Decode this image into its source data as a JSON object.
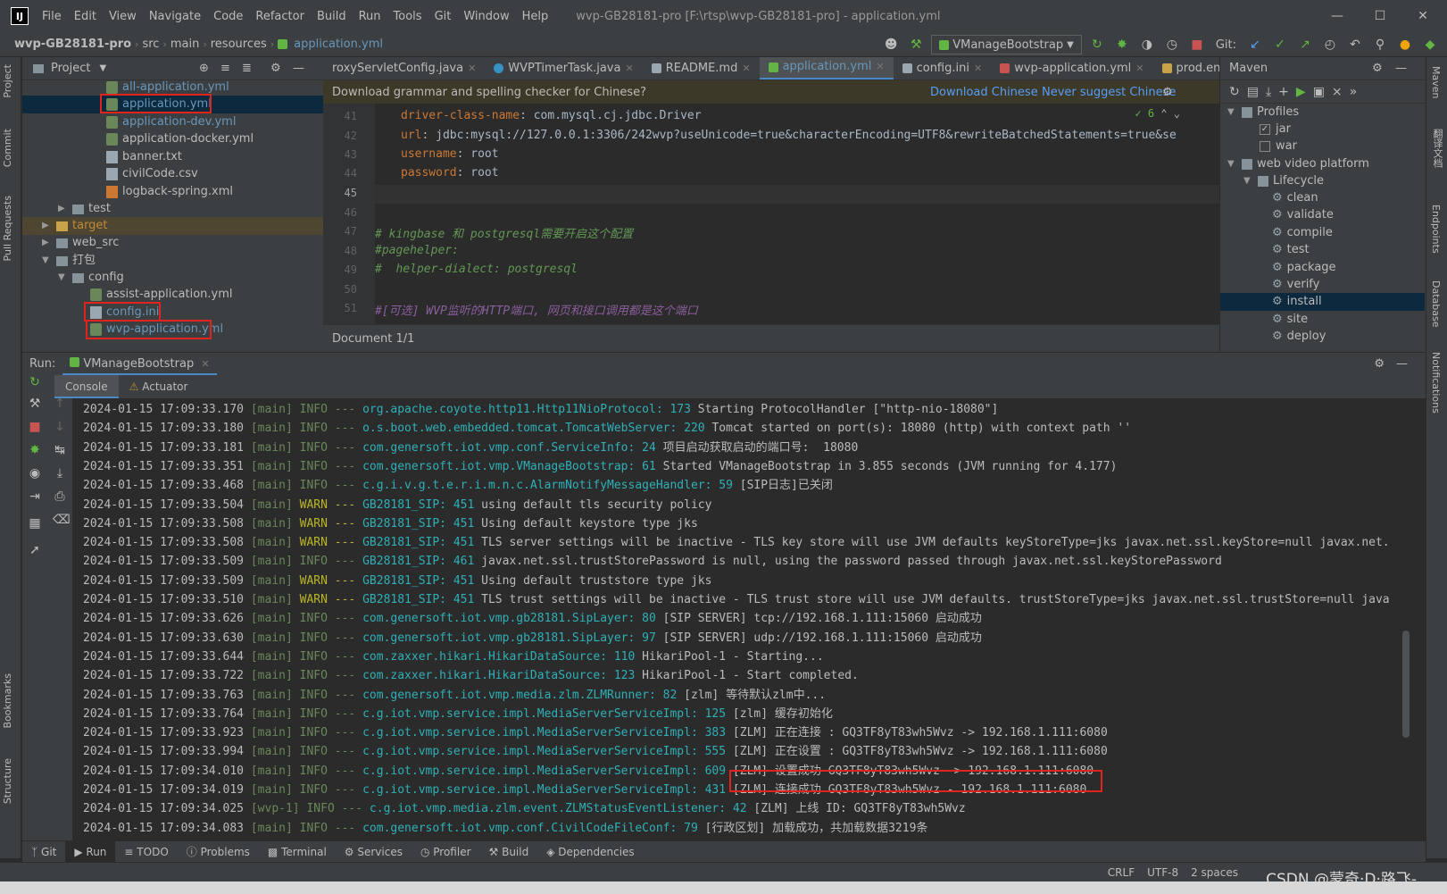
{
  "titlebar": {
    "app_icon": "IJ",
    "menu": [
      "File",
      "Edit",
      "View",
      "Navigate",
      "Code",
      "Refactor",
      "Build",
      "Run",
      "Tools",
      "Git",
      "Window",
      "Help"
    ],
    "window_title": "wvp-GB28181-pro [F:\\rtsp\\wvp-GB28181-pro] - application.yml"
  },
  "navbar": {
    "breadcrumbs": [
      "wvp-GB28181-pro",
      "src",
      "main",
      "resources",
      "application.yml"
    ],
    "run_config": "VManageBootstrap",
    "git_label": "Git:"
  },
  "project": {
    "title": "Project",
    "rows": [
      {
        "label": "all-application.yml",
        "icon": "yml-icon",
        "indent": 4
      },
      {
        "label": "application.yml",
        "icon": "yml-icon",
        "indent": 4
      },
      {
        "label": "application-dev.yml",
        "icon": "yml-icon",
        "indent": 4
      },
      {
        "label": "application-docker.yml",
        "icon": "yml-icon",
        "indent": 4
      },
      {
        "label": "banner.txt",
        "icon": "txt-icon",
        "indent": 4
      },
      {
        "label": "civilCode.csv",
        "icon": "txt-icon",
        "indent": 4
      },
      {
        "label": "logback-spring.xml",
        "icon": "xml-icon",
        "indent": 4
      },
      {
        "label": "test",
        "icon": "folder-icon",
        "indent": 2
      },
      {
        "label": "target",
        "icon": "folder-icon",
        "indent": 1
      },
      {
        "label": "web_src",
        "icon": "folder-icon",
        "indent": 1
      },
      {
        "label": "打包",
        "icon": "folder-icon",
        "indent": 1
      },
      {
        "label": "config",
        "icon": "folder-icon",
        "indent": 2
      },
      {
        "label": "assist-application.yml",
        "icon": "yml-icon",
        "indent": 3
      },
      {
        "label": "config.ini",
        "icon": "ini-icon",
        "indent": 3
      },
      {
        "label": "wvp-application.yml",
        "icon": "yml-icon",
        "indent": 3
      }
    ]
  },
  "editor": {
    "tabs": [
      {
        "label": "roxyServletConfig.java"
      },
      {
        "label": "WVPTimerTask.java"
      },
      {
        "label": "README.md"
      },
      {
        "label": "application.yml",
        "active": true
      },
      {
        "label": "config.ini"
      },
      {
        "label": "wvp-application.yml"
      },
      {
        "label": "prod.env.js"
      }
    ],
    "banner_text": "Download grammar and spelling checker for Chinese?",
    "banner_link1": "Download Chinese",
    "banner_link2": "Never suggest Chinese",
    "inspection_count": "6",
    "lines": [
      {
        "num": "41",
        "key": "driver-class-name",
        "value": "com.mysql.cj.jdbc.Driver"
      },
      {
        "num": "42",
        "key": "url",
        "value": "jdbc:mysql://127.0.0.1:3306/242wvp?useUnicode=true&characterEncoding=UTF8&rewriteBatchedStatements=true&se"
      },
      {
        "num": "43",
        "key": "username",
        "value": "root"
      },
      {
        "num": "44",
        "key": "password",
        "value": "root"
      },
      {
        "num": "45",
        "text": ""
      },
      {
        "num": "46",
        "text": ""
      },
      {
        "num": "47",
        "comment": "# kingbase 和 postgresql需要开启这个配置"
      },
      {
        "num": "48",
        "comment": "#pagehelper:"
      },
      {
        "num": "49",
        "comment": "#  helper-dialect: postgresql"
      },
      {
        "num": "50",
        "text": ""
      },
      {
        "num": "51",
        "comment": "#[可选] WVP监听的HTTP端口, 网页和接口调用都是这个端口"
      }
    ],
    "status": "Document 1/1"
  },
  "maven": {
    "title": "Maven",
    "rows": [
      {
        "label": "Profiles"
      },
      {
        "label": "jar",
        "checked": true
      },
      {
        "label": "war",
        "checked": false
      },
      {
        "label": "web video platform"
      },
      {
        "label": "Lifecycle"
      },
      {
        "label": "clean"
      },
      {
        "label": "validate"
      },
      {
        "label": "compile"
      },
      {
        "label": "test"
      },
      {
        "label": "package"
      },
      {
        "label": "verify"
      },
      {
        "label": "install"
      },
      {
        "label": "site"
      },
      {
        "label": "deploy"
      }
    ]
  },
  "run": {
    "label": "Run:",
    "tab": "VManageBootstrap",
    "console_tab": "Console",
    "actuator_tab": "Actuator",
    "logs": [
      {
        "ts": "2024-01-15 17:09:33.170",
        "th": "[main]",
        "lvl": "INFO",
        "cls": "org.apache.coyote.http11.Http11NioProtocol: 173",
        "msg": "Starting ProtocolHandler [\"http-nio-18080\"]"
      },
      {
        "ts": "2024-01-15 17:09:33.180",
        "th": "[main]",
        "lvl": "INFO",
        "cls": "o.s.boot.web.embedded.tomcat.TomcatWebServer: 220",
        "msg": "Tomcat started on port(s): 18080 (http) with context path ''"
      },
      {
        "ts": "2024-01-15 17:09:33.181",
        "th": "[main]",
        "lvl": "INFO",
        "cls": "com.genersoft.iot.vmp.conf.ServiceInfo: 24",
        "msg": "项目启动获取启动的端口号:  18080"
      },
      {
        "ts": "2024-01-15 17:09:33.351",
        "th": "[main]",
        "lvl": "INFO",
        "cls": "com.genersoft.iot.vmp.VManageBootstrap: 61",
        "msg": "Started VManageBootstrap in 3.855 seconds (JVM running for 4.177)"
      },
      {
        "ts": "2024-01-15 17:09:33.468",
        "th": "[main]",
        "lvl": "INFO",
        "cls": "c.g.i.v.g.t.e.r.i.m.n.c.AlarmNotifyMessageHandler: 59",
        "msg": "[SIP日志]已关闭"
      },
      {
        "ts": "2024-01-15 17:09:33.504",
        "th": "[main]",
        "lvl": "WARN",
        "cls": "GB28181_SIP: 451",
        "msg": "using default tls security policy"
      },
      {
        "ts": "2024-01-15 17:09:33.508",
        "th": "[main]",
        "lvl": "WARN",
        "cls": "GB28181_SIP: 451",
        "msg": "Using default keystore type jks"
      },
      {
        "ts": "2024-01-15 17:09:33.508",
        "th": "[main]",
        "lvl": "WARN",
        "cls": "GB28181_SIP: 451",
        "msg": "TLS server settings will be inactive - TLS key store will use JVM defaults keyStoreType=jks javax.net.ssl.keyStore=null javax.net."
      },
      {
        "ts": "2024-01-15 17:09:33.509",
        "th": "[main]",
        "lvl": "INFO",
        "cls": "GB28181_SIP: 461",
        "msg": "javax.net.ssl.trustStorePassword is null, using the password passed through javax.net.ssl.keyStorePassword"
      },
      {
        "ts": "2024-01-15 17:09:33.509",
        "th": "[main]",
        "lvl": "WARN",
        "cls": "GB28181_SIP: 451",
        "msg": "Using default truststore type jks"
      },
      {
        "ts": "2024-01-15 17:09:33.510",
        "th": "[main]",
        "lvl": "WARN",
        "cls": "GB28181_SIP: 451",
        "msg": "TLS trust settings will be inactive - TLS trust store will use JVM defaults. trustStoreType=jks javax.net.ssl.trustStore=null java"
      },
      {
        "ts": "2024-01-15 17:09:33.626",
        "th": "[main]",
        "lvl": "INFO",
        "cls": "com.genersoft.iot.vmp.gb28181.SipLayer: 80",
        "msg": "[SIP SERVER] tcp://192.168.1.111:15060 启动成功"
      },
      {
        "ts": "2024-01-15 17:09:33.630",
        "th": "[main]",
        "lvl": "INFO",
        "cls": "com.genersoft.iot.vmp.gb28181.SipLayer: 97",
        "msg": "[SIP SERVER] udp://192.168.1.111:15060 启动成功"
      },
      {
        "ts": "2024-01-15 17:09:33.644",
        "th": "[main]",
        "lvl": "INFO",
        "cls": "com.zaxxer.hikari.HikariDataSource: 110",
        "msg": "HikariPool-1 - Starting..."
      },
      {
        "ts": "2024-01-15 17:09:33.722",
        "th": "[main]",
        "lvl": "INFO",
        "cls": "com.zaxxer.hikari.HikariDataSource: 123",
        "msg": "HikariPool-1 - Start completed."
      },
      {
        "ts": "2024-01-15 17:09:33.763",
        "th": "[main]",
        "lvl": "INFO",
        "cls": "com.genersoft.iot.vmp.media.zlm.ZLMRunner: 82",
        "msg": "[zlm] 等待默认zlm中..."
      },
      {
        "ts": "2024-01-15 17:09:33.764",
        "th": "[main]",
        "lvl": "INFO",
        "cls": "c.g.iot.vmp.service.impl.MediaServerServiceImpl: 125",
        "msg": "[zlm] 缓存初始化"
      },
      {
        "ts": "2024-01-15 17:09:33.923",
        "th": "[main]",
        "lvl": "INFO",
        "cls": "c.g.iot.vmp.service.impl.MediaServerServiceImpl: 383",
        "msg": "[ZLM] 正在连接 : GQ3TF8yT83wh5Wvz -> 192.168.1.111:6080"
      },
      {
        "ts": "2024-01-15 17:09:33.994",
        "th": "[main]",
        "lvl": "INFO",
        "cls": "c.g.iot.vmp.service.impl.MediaServerServiceImpl: 555",
        "msg": "[ZLM] 正在设置 : GQ3TF8yT83wh5Wvz -> 192.168.1.111:6080"
      },
      {
        "ts": "2024-01-15 17:09:34.010",
        "th": "[main]",
        "lvl": "INFO",
        "cls": "c.g.iot.vmp.service.impl.MediaServerServiceImpl: 609",
        "msg": "[ZLM] 设置成功 GQ3TF8yT83wh5Wvz -> 192.168.1.111:6080"
      },
      {
        "ts": "2024-01-15 17:09:34.019",
        "th": "[main]",
        "lvl": "INFO",
        "cls": "c.g.iot.vmp.service.impl.MediaServerServiceImpl: 431",
        "msg": "[ZLM] 连接成功 GQ3TF8yT83wh5Wvz - 192.168.1.111:6080"
      },
      {
        "ts": "2024-01-15 17:09:34.025",
        "th": "[wvp-1]",
        "lvl": "INFO",
        "cls": "c.g.iot.vmp.media.zlm.event.ZLMStatusEventListener: 42",
        "msg": "[ZLM] 上线 ID: GQ3TF8yT83wh5Wvz"
      },
      {
        "ts": "2024-01-15 17:09:34.083",
        "th": "[main]",
        "lvl": "INFO",
        "cls": "com.genersoft.iot.vmp.conf.CivilCodeFileConf: 79",
        "msg": "[行政区划] 加载成功，共加载数据3219条"
      }
    ]
  },
  "bottom_tabs": [
    "Git",
    "Run",
    "TODO",
    "Problems",
    "Terminal",
    "Services",
    "Profiler",
    "Build",
    "Dependencies"
  ],
  "statusbar": {
    "line_sep": "CRLF",
    "encoding": "UTF-8",
    "indent": "2 spaces"
  },
  "left_strip": [
    "Project",
    "Commit",
    "Pull Requests",
    "Bookmarks",
    "Structure"
  ],
  "right_strip": [
    "Maven",
    "翻译文档",
    "Endpoints",
    "Database",
    "Notifications"
  ],
  "watermark": "CSDN @蒙奇·D·路飞-"
}
